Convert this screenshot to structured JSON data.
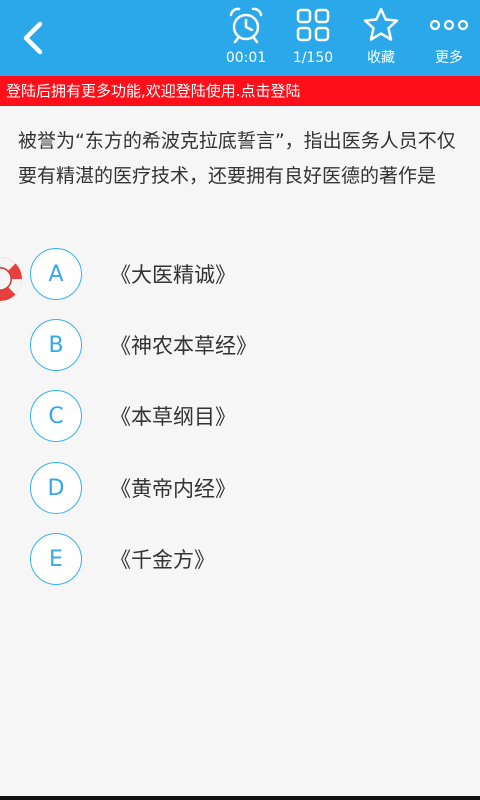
{
  "toolbar": {
    "timer_label": "00:01",
    "progress_label": "1/150",
    "favorite_label": "收藏",
    "more_label": "更多"
  },
  "banner": {
    "text": "登陆后拥有更多功能,欢迎登陆使用.点击登陆"
  },
  "question": {
    "text": "被誉为“东方的希波克拉底誓言”，指出医务人员不仅要有精湛的医疗技术，还要拥有良好医德的著作是"
  },
  "options": [
    {
      "letter": "A",
      "text": "《大医精诚》"
    },
    {
      "letter": "B",
      "text": "《神农本草经》"
    },
    {
      "letter": "C",
      "text": "《本草纲目》"
    },
    {
      "letter": "D",
      "text": "《黄帝内经》"
    },
    {
      "letter": "E",
      "text": "《千金方》"
    }
  ],
  "colors": {
    "toolbar_bg": "#2aa8ea",
    "banner_bg": "#ff0f1a",
    "option_accent": "#34a8ea",
    "lifebuoy": "#e8403c"
  },
  "icons": {
    "back": "chevron-left-icon",
    "timer": "alarm-clock-icon",
    "progress": "grid-icon",
    "favorite": "star-icon",
    "more": "more-dots-icon",
    "hint": "lifebuoy-icon"
  }
}
